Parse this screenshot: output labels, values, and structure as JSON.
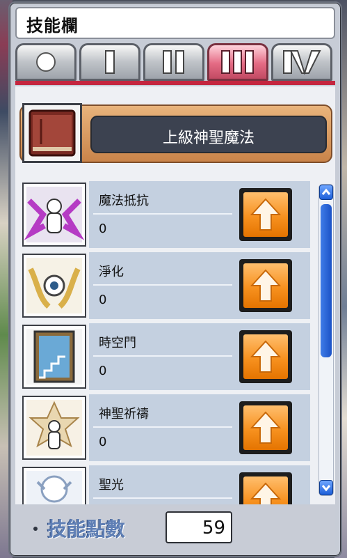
{
  "window": {
    "title": "技能欄"
  },
  "tabs": [
    {
      "label": "○",
      "icon": "circle-icon",
      "active": false
    },
    {
      "label": "I",
      "icon": "roman-1-icon",
      "active": false
    },
    {
      "label": "II",
      "icon": "roman-2-icon",
      "active": false
    },
    {
      "label": "III",
      "icon": "roman-3-icon",
      "active": true
    },
    {
      "label": "IV",
      "icon": "roman-4-icon",
      "active": false
    }
  ],
  "job": {
    "name": "上級神聖魔法",
    "icon": "skill-book-icon"
  },
  "skills": [
    {
      "name": "魔法抵抗",
      "level": "0",
      "icon": "magic-resistance-icon"
    },
    {
      "name": "淨化",
      "level": "0",
      "icon": "purification-icon"
    },
    {
      "name": "時空門",
      "level": "0",
      "icon": "mystic-door-icon"
    },
    {
      "name": "神聖祈禱",
      "level": "0",
      "icon": "holy-prayer-icon"
    },
    {
      "name": "聖光",
      "level": "",
      "icon": "holy-light-icon"
    }
  ],
  "footer": {
    "sp_label": "技能點數",
    "sp_value": "59"
  },
  "colors": {
    "active_tab": "#e46b84",
    "accent_red": "#c4263f",
    "button_orange": "#f7911f",
    "scroll_blue": "#1d5fd8"
  }
}
